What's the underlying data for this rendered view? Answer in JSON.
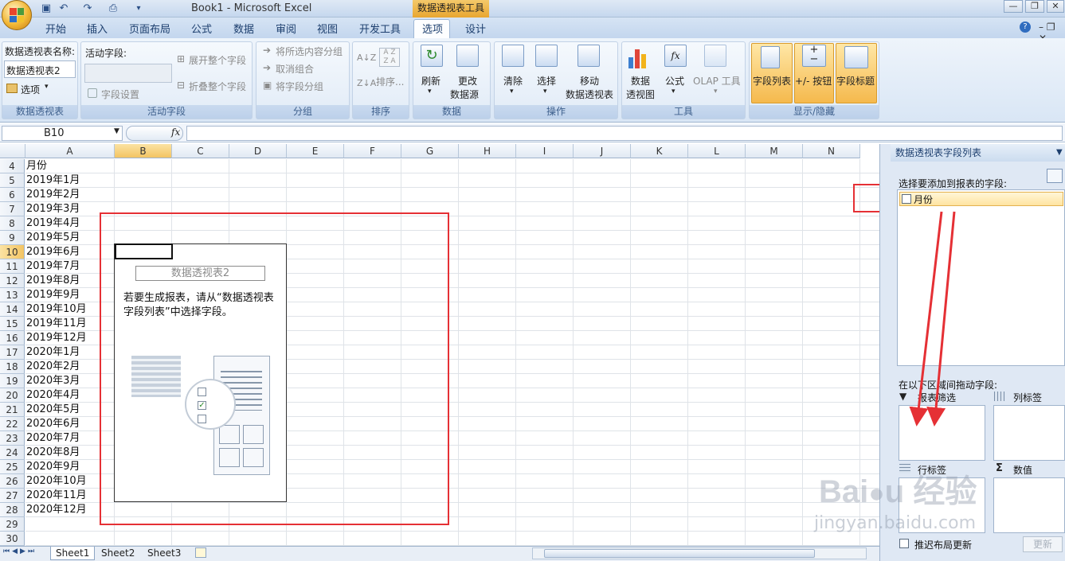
{
  "window": {
    "title": "Book1 - Microsoft Excel",
    "tool_tab": "数据透视表工具"
  },
  "tabs": [
    "开始",
    "插入",
    "页面布局",
    "公式",
    "数据",
    "审阅",
    "视图",
    "开发工具",
    "选项",
    "设计"
  ],
  "active_tab": "选项",
  "ribbon": {
    "pivot_name_label": "数据透视表名称:",
    "pivot_name_value": "数据透视表2",
    "options_btn": "选项",
    "group_pivot": "数据透视表",
    "active_field_label": "活动字段:",
    "field_settings": "字段设置",
    "expand_all": "展开整个字段",
    "collapse_all": "折叠整个字段",
    "group_active": "活动字段",
    "group_selection": "将所选内容分组",
    "ungroup": "取消组合",
    "group_field": "将字段分组",
    "group_group": "分组",
    "sort": "排序...",
    "group_sort": "排序",
    "refresh": "刷新",
    "change_source_1": "更改",
    "change_source_2": "数据源",
    "group_data": "数据",
    "clear": "清除",
    "select": "选择",
    "move_1": "移动",
    "move_2": "数据透视表",
    "group_actions": "操作",
    "pivotchart_1": "数据",
    "pivotchart_2": "透视图",
    "formulas": "公式",
    "olap": "OLAP 工具",
    "group_tools": "工具",
    "field_list": "字段列表",
    "buttons": "+/- 按钮",
    "field_headers": "字段标题",
    "group_show": "显示/隐藏"
  },
  "formula_bar": {
    "name_box": "B10",
    "fx": "fx",
    "content": ""
  },
  "columns": [
    "A",
    "B",
    "C",
    "D",
    "E",
    "F",
    "G",
    "H",
    "I",
    "J",
    "K",
    "L",
    "M",
    "N"
  ],
  "rows": [
    {
      "n": "4",
      "a": "月份"
    },
    {
      "n": "5",
      "a": "2019年1月"
    },
    {
      "n": "6",
      "a": "2019年2月"
    },
    {
      "n": "7",
      "a": "2019年3月"
    },
    {
      "n": "8",
      "a": "2019年4月"
    },
    {
      "n": "9",
      "a": "2019年5月"
    },
    {
      "n": "10",
      "a": "2019年6月"
    },
    {
      "n": "11",
      "a": "2019年7月"
    },
    {
      "n": "12",
      "a": "2019年8月"
    },
    {
      "n": "13",
      "a": "2019年9月"
    },
    {
      "n": "14",
      "a": "2019年10月"
    },
    {
      "n": "15",
      "a": "2019年11月"
    },
    {
      "n": "16",
      "a": "2019年12月"
    },
    {
      "n": "17",
      "a": "2020年1月"
    },
    {
      "n": "18",
      "a": "2020年2月"
    },
    {
      "n": "19",
      "a": "2020年3月"
    },
    {
      "n": "20",
      "a": "2020年4月"
    },
    {
      "n": "21",
      "a": "2020年5月"
    },
    {
      "n": "22",
      "a": "2020年6月"
    },
    {
      "n": "23",
      "a": "2020年7月"
    },
    {
      "n": "24",
      "a": "2020年8月"
    },
    {
      "n": "25",
      "a": "2020年9月"
    },
    {
      "n": "26",
      "a": "2020年10月"
    },
    {
      "n": "27",
      "a": "2020年11月"
    },
    {
      "n": "28",
      "a": "2020年12月"
    },
    {
      "n": "29",
      "a": ""
    },
    {
      "n": "30",
      "a": ""
    }
  ],
  "pivot_placeholder": {
    "title": "数据透视表2",
    "message": "若要生成报表，请从“数据透视表字段列表”中选择字段。"
  },
  "sheets": [
    "Sheet1",
    "Sheet2",
    "Sheet3"
  ],
  "field_pane": {
    "title": "数据透视表字段列表",
    "choose_label": "选择要添加到报表的字段:",
    "fields": [
      "月份"
    ],
    "drag_label": "在以下区域间拖动字段:",
    "report_filter": "报表筛选",
    "column_labels": "列标签",
    "row_labels": "行标签",
    "values": "数值",
    "defer_update": "推迟布局更新",
    "update_btn": "更新"
  },
  "watermark": {
    "logo": "Baidu经验",
    "url": "jingyan.baidu.com"
  },
  "colors": {
    "accent_red": "#e53035",
    "active_tab_orange": "#f5b94d",
    "ribbon_blue": "#dbe7f5"
  }
}
